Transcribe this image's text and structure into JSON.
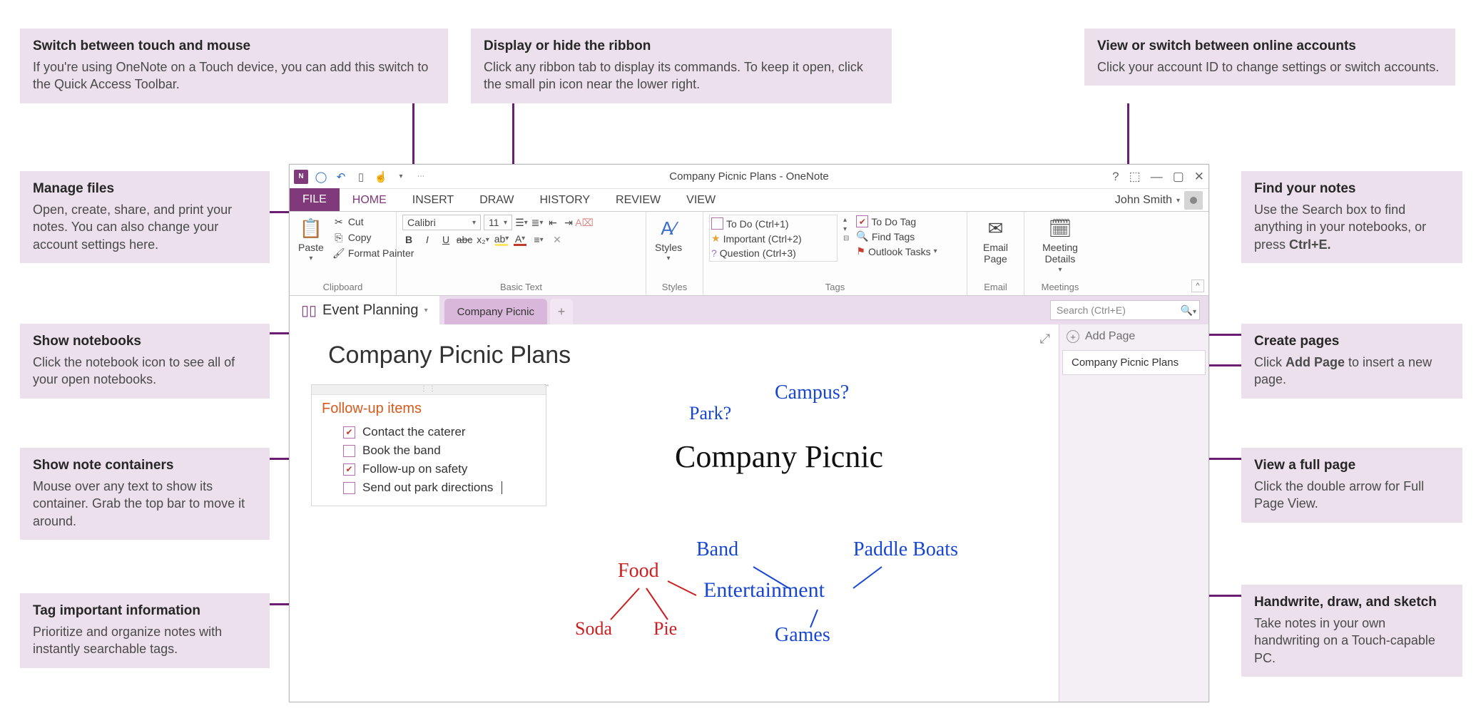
{
  "callouts": {
    "touch": {
      "title": "Switch between touch and mouse",
      "body": "If you're using OneNote on a Touch device, you can add this switch to the Quick Access Toolbar."
    },
    "ribbon_hide": {
      "title": "Display or hide the ribbon",
      "body": "Click any ribbon tab to display its commands. To keep it open, click the small pin icon near the lower right."
    },
    "accounts": {
      "title": "View or switch between online accounts",
      "body": "Click your account ID to change settings or switch accounts."
    },
    "files": {
      "title": "Manage files",
      "body": "Open, create, share, and print your notes. You can also change your account settings here."
    },
    "search": {
      "title": "Find your notes",
      "body_pre": "Use the Search box to find anything in your notebooks, or press ",
      "body_bold": "Ctrl+E."
    },
    "notebooks": {
      "title": "Show notebooks",
      "body": "Click the notebook icon to see all of your open notebooks."
    },
    "pages": {
      "title": "Create pages",
      "body_pre": "Click ",
      "body_bold": "Add Page",
      "body_post": " to insert a new page."
    },
    "containers": {
      "title": "Show note containers",
      "body": "Mouse over any text to show its container. Grab the top bar to move it around."
    },
    "fullpage": {
      "title": "View a full page",
      "body": "Click the double arrow for Full Page View."
    },
    "tags": {
      "title": "Tag important information",
      "body": "Prioritize and organize notes with instantly searchable tags."
    },
    "handwrite": {
      "title": "Handwrite, draw, and sketch",
      "body": "Take notes in your own handwriting on a Touch-capable PC."
    }
  },
  "window_title": "Company Picnic Plans - OneNote",
  "account": "John Smith",
  "ribbon_tabs": {
    "file": "FILE",
    "home": "HOME",
    "insert": "INSERT",
    "draw": "DRAW",
    "history": "HISTORY",
    "review": "REVIEW",
    "view": "VIEW"
  },
  "clipboard": {
    "paste": "Paste",
    "cut": "Cut",
    "copy": "Copy",
    "format_painter": "Format Painter",
    "label": "Clipboard"
  },
  "basic_text": {
    "font": "Calibri",
    "size": "11",
    "label": "Basic Text"
  },
  "styles": {
    "btn": "Styles",
    "label": "Styles"
  },
  "tags": {
    "todo": "To Do (Ctrl+1)",
    "important": "Important (Ctrl+2)",
    "question": "Question (Ctrl+3)",
    "todo_tag": "To Do Tag",
    "find_tags": "Find Tags",
    "outlook": "Outlook Tasks",
    "label": "Tags"
  },
  "email": {
    "btn": "Email Page",
    "label": "Email"
  },
  "meetings": {
    "btn": "Meeting Details",
    "label": "Meetings"
  },
  "notebook": "Event Planning",
  "section": "Company Picnic",
  "search_placeholder": "Search (Ctrl+E)",
  "add_page": "Add Page",
  "page_list_item": "Company Picnic Plans",
  "page_title": "Company Picnic Plans",
  "note": {
    "title": "Follow-up items",
    "items": [
      {
        "checked": true,
        "text": "Contact the caterer"
      },
      {
        "checked": false,
        "text": "Book the band"
      },
      {
        "checked": true,
        "text": "Follow-up on safety"
      },
      {
        "checked": false,
        "text": "Send out park directions"
      }
    ]
  },
  "handwriting": {
    "park": "Park?",
    "campus": "Campus?",
    "title": "Company Picnic",
    "band": "Band",
    "paddle": "Paddle Boats",
    "entertainment": "Entertainment",
    "games": "Games",
    "food": "Food",
    "soda": "Soda",
    "pie": "Pie"
  }
}
